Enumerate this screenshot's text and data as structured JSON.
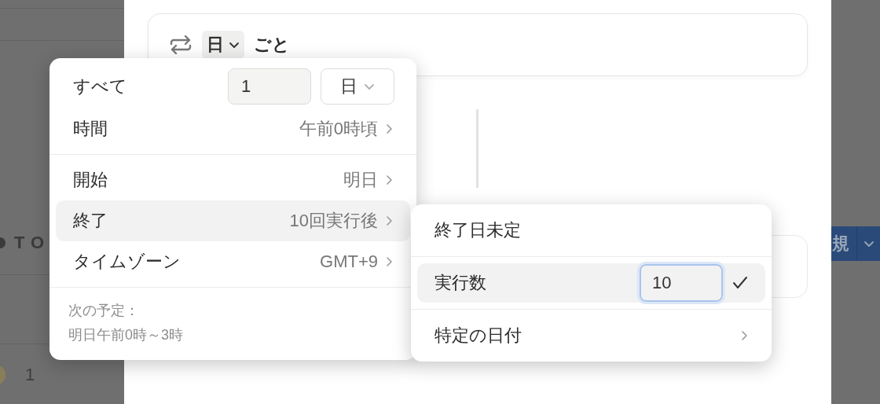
{
  "background": {
    "left_label": "TO",
    "left_count": "1",
    "right_button": "規"
  },
  "recurrence": {
    "unit": "日",
    "suffix": "ごと"
  },
  "menu": {
    "sections": [
      [
        {
          "kind": "stepper",
          "label": "すべて",
          "value": "1",
          "unit": "日",
          "selected": false
        },
        {
          "kind": "link",
          "label": "時間",
          "value": "午前0時頃",
          "selected": false
        }
      ],
      [
        {
          "kind": "link",
          "label": "開始",
          "value": "明日",
          "selected": false
        },
        {
          "kind": "link",
          "label": "終了",
          "value": "10回実行後",
          "selected": true
        },
        {
          "kind": "link",
          "label": "タイムゾーン",
          "value": "GMT+9",
          "selected": false
        }
      ]
    ],
    "footer": [
      "次の予定：",
      "明日午前0時～3時"
    ]
  },
  "submenu": {
    "items": [
      {
        "kind": "plain",
        "label": "終了日未定",
        "selected": false
      },
      {
        "kind": "count",
        "label": "実行数",
        "value": "10",
        "selected": true,
        "checked": true
      },
      {
        "kind": "link",
        "label": "特定の日付",
        "selected": false
      }
    ]
  }
}
